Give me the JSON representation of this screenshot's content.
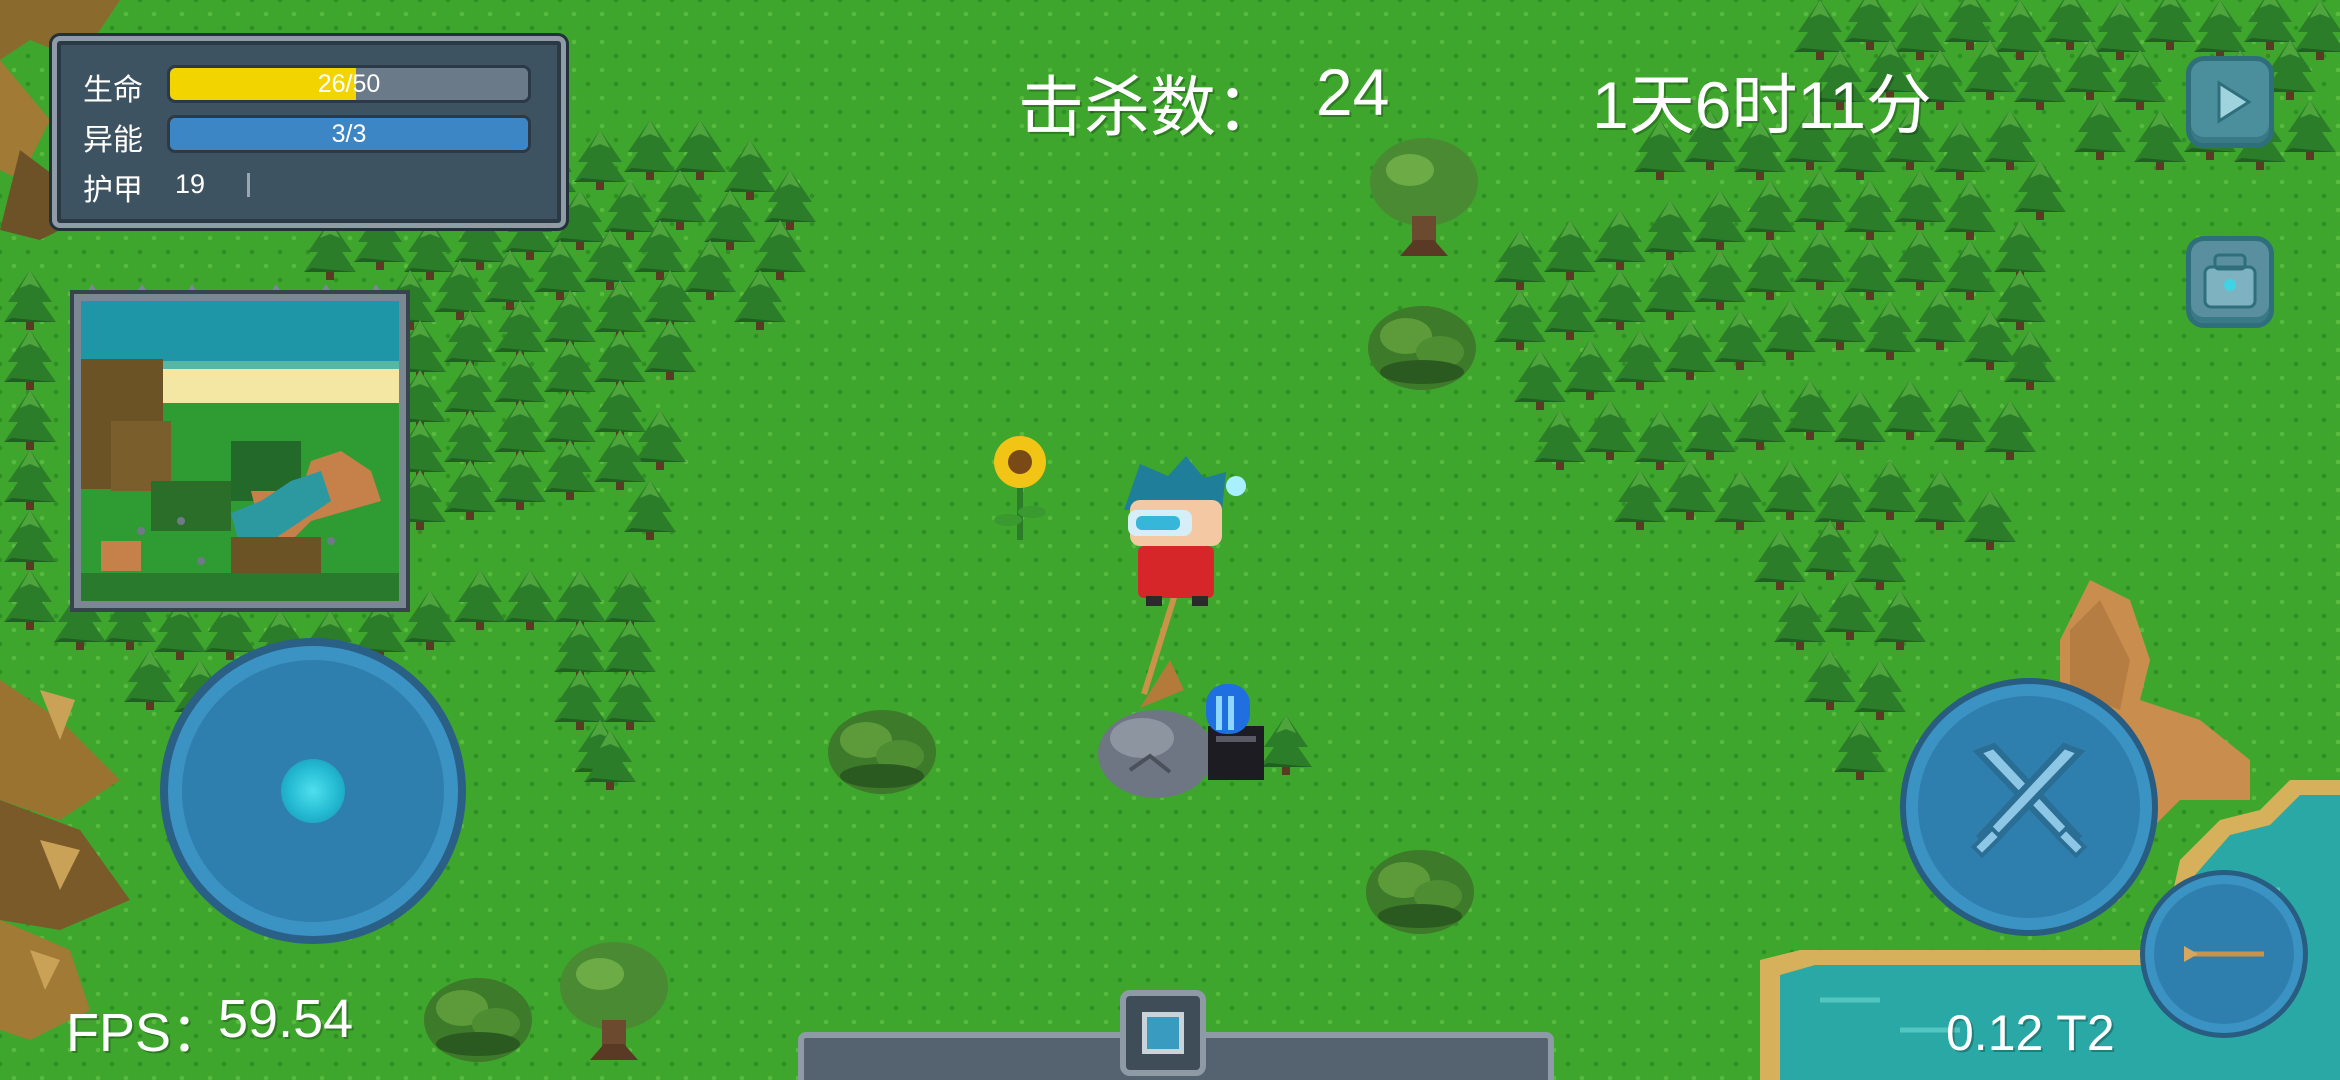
{
  "hud": {
    "status": {
      "hp_label": "生命",
      "hp_text": "26/50",
      "hp_ratio": 0.52,
      "energy_label": "异能",
      "energy_text": "3/3",
      "energy_ratio": 1.0,
      "armor_label": "护甲",
      "armor_value": "19"
    },
    "kills_label": "击杀数：",
    "kills_value": "24",
    "clock": "1天6时11分",
    "fps_label": "FPS：",
    "fps_value": "59.54",
    "version": "0.12 T2"
  },
  "controls": {
    "play_icon": "play-icon",
    "backpack_icon": "backpack-icon",
    "attack_icon": "crossed-swords-icon",
    "weapon_icon": "spear-icon",
    "joystick_icon": "joystick-knob"
  },
  "colors": {
    "grass": "#3ea62d",
    "hp_fill": "#f2d500",
    "energy_fill": "#3d86c5",
    "ui_blue": "#2f7fae",
    "water": "#2aa8a5",
    "dirt": "#c98d4e"
  }
}
